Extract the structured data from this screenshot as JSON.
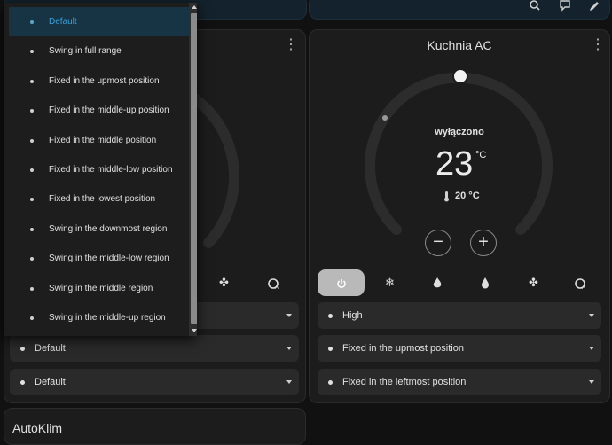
{
  "topbar": {
    "icons": [
      "search-icon",
      "chat-icon",
      "edit-icon"
    ]
  },
  "left_card": {
    "dial_level": 0.55,
    "mode_icons": [
      "fan-icon",
      "auto-icon"
    ],
    "selects": [
      {
        "value": "Default"
      },
      {
        "value": "Default"
      }
    ],
    "dropdown": {
      "options": [
        "Default",
        "Swing in full range",
        "Fixed in the upmost position",
        "Fixed in the middle-up position",
        "Fixed in the middle position",
        "Fixed in the middle-low position",
        "Fixed in the lowest position",
        "Swing in the downmost region",
        "Swing in the middle-low region",
        "Swing in the middle region",
        "Swing in the middle-up region"
      ],
      "selected": "Default"
    }
  },
  "right_card": {
    "title": "Kuchnia AC",
    "status": "wyłączono",
    "target_temp": "23",
    "target_unit": "°C",
    "current_temp": "20 °C",
    "mode_icons": [
      "power-icon",
      "snowflake-icon",
      "flame-icon",
      "water-drop-icon",
      "fan-icon",
      "auto-icon"
    ],
    "active_mode": "power-icon",
    "selects": [
      {
        "value": "High"
      },
      {
        "value": "Fixed in the upmost position"
      },
      {
        "value": "Fixed in the leftmost position"
      }
    ]
  },
  "bottom_card": {
    "title": "AutoKlim"
  },
  "colors": {
    "background": "#111111",
    "card": "#1c1c1c",
    "accent": "#3aa0dc",
    "active_mode": "#b9b9b9"
  }
}
